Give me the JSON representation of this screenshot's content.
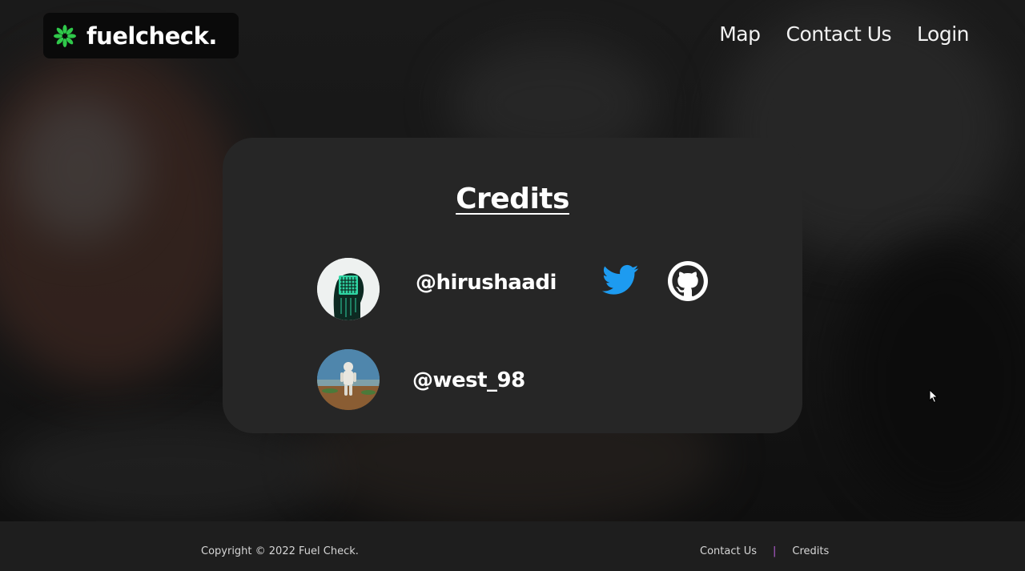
{
  "header": {
    "brand": "fuelcheck.",
    "logo_icon": "green-burst-icon",
    "nav": [
      {
        "label": "Map"
      },
      {
        "label": "Contact Us"
      },
      {
        "label": "Login"
      }
    ]
  },
  "credits": {
    "title": "Credits",
    "people": [
      {
        "handle": "@hirushaadi",
        "avatar": "circuit-head-avatar",
        "links": [
          "twitter-icon",
          "github-icon"
        ]
      },
      {
        "handle": "@west_98",
        "avatar": "astronaut-avatar",
        "links": []
      }
    ]
  },
  "footer": {
    "copyright": "Copyright © 2022 Fuel Check.",
    "links": [
      {
        "label": "Contact Us"
      },
      {
        "label": "Credits"
      }
    ],
    "separator": "|"
  },
  "colors": {
    "twitter": "#1d9bf0",
    "logo_green": "#2fc84a",
    "card": "#262626",
    "footer": "#1e1e1e",
    "separator": "#b65fd6"
  }
}
